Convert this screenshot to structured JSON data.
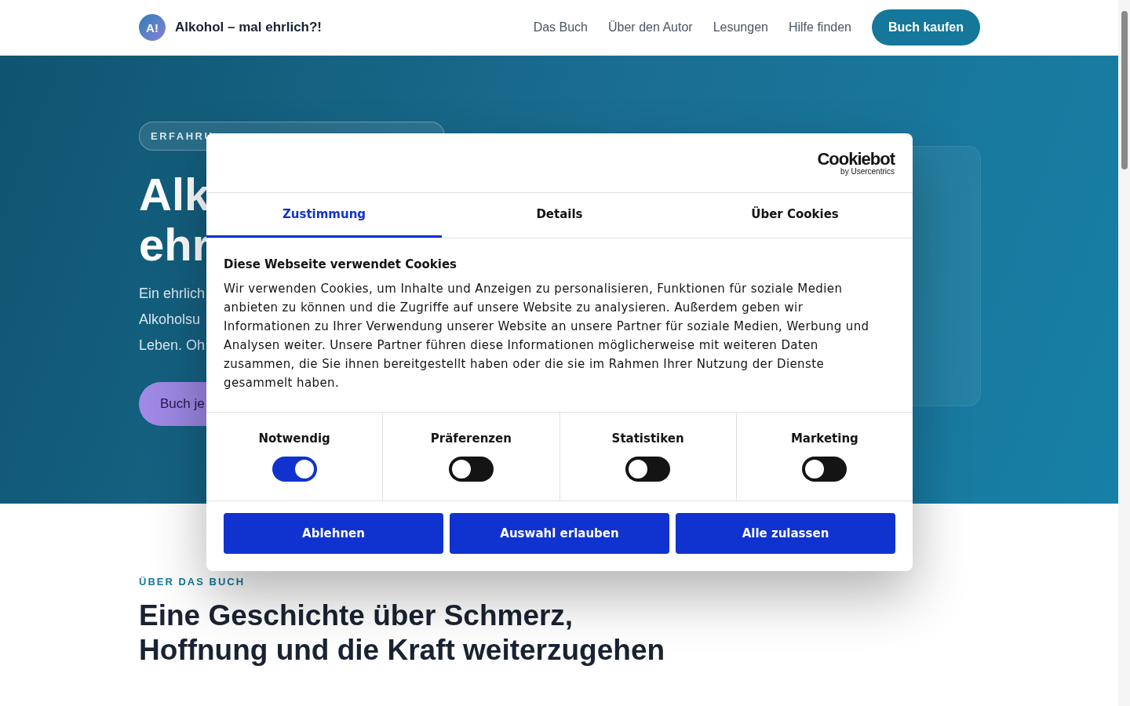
{
  "header": {
    "logo_mark": "A!",
    "site_title": "Alkohol – mal ehrlich?!",
    "nav": [
      "Das Buch",
      "Über den Autor",
      "Lesungen",
      "Hilfe finden"
    ],
    "cta": "Buch kaufen"
  },
  "hero": {
    "badge": "ERFAHRU",
    "title_lines": [
      "Alk",
      "ehr"
    ],
    "lead_lines": [
      "Ein ehrlich",
      "Alkoholsu",
      "Leben. Oh"
    ],
    "button": "Buch je"
  },
  "about": {
    "eyebrow": "ÜBER DAS BUCH",
    "heading_lines": [
      "Eine Geschichte über Schmerz,",
      "Hoffnung und die Kraft weiterzugehen"
    ]
  },
  "cookie_dialog": {
    "brand": "Cookiebot",
    "brand_sub": "by Usercentrics",
    "tabs": [
      {
        "label": "Zustimmung",
        "selected": true
      },
      {
        "label": "Details",
        "selected": false
      },
      {
        "label": "Über Cookies",
        "selected": false
      }
    ],
    "title": "Diese Webseite verwendet Cookies",
    "text": "Wir verwenden Cookies, um Inhalte und Anzeigen zu personalisieren, Funktionen für soziale Medien anbieten zu können und die Zugriffe auf unsere Website zu analysieren. Außerdem geben wir Informationen zu Ihrer Verwendung unserer Website an unsere Partner für soziale Medien, Werbung und Analysen weiter. Unsere Partner führen diese Informationen möglicherweise mit weiteren Daten zusammen, die Sie ihnen bereitgestellt haben oder die sie im Rahmen Ihrer Nutzung der Dienste gesammelt haben.",
    "categories": [
      {
        "label": "Notwendig",
        "on": true
      },
      {
        "label": "Präferenzen",
        "on": false
      },
      {
        "label": "Statistiken",
        "on": false
      },
      {
        "label": "Marketing",
        "on": false
      }
    ],
    "buttons": [
      "Ablehnen",
      "Auswahl erlauben",
      "Alle zulassen"
    ]
  }
}
